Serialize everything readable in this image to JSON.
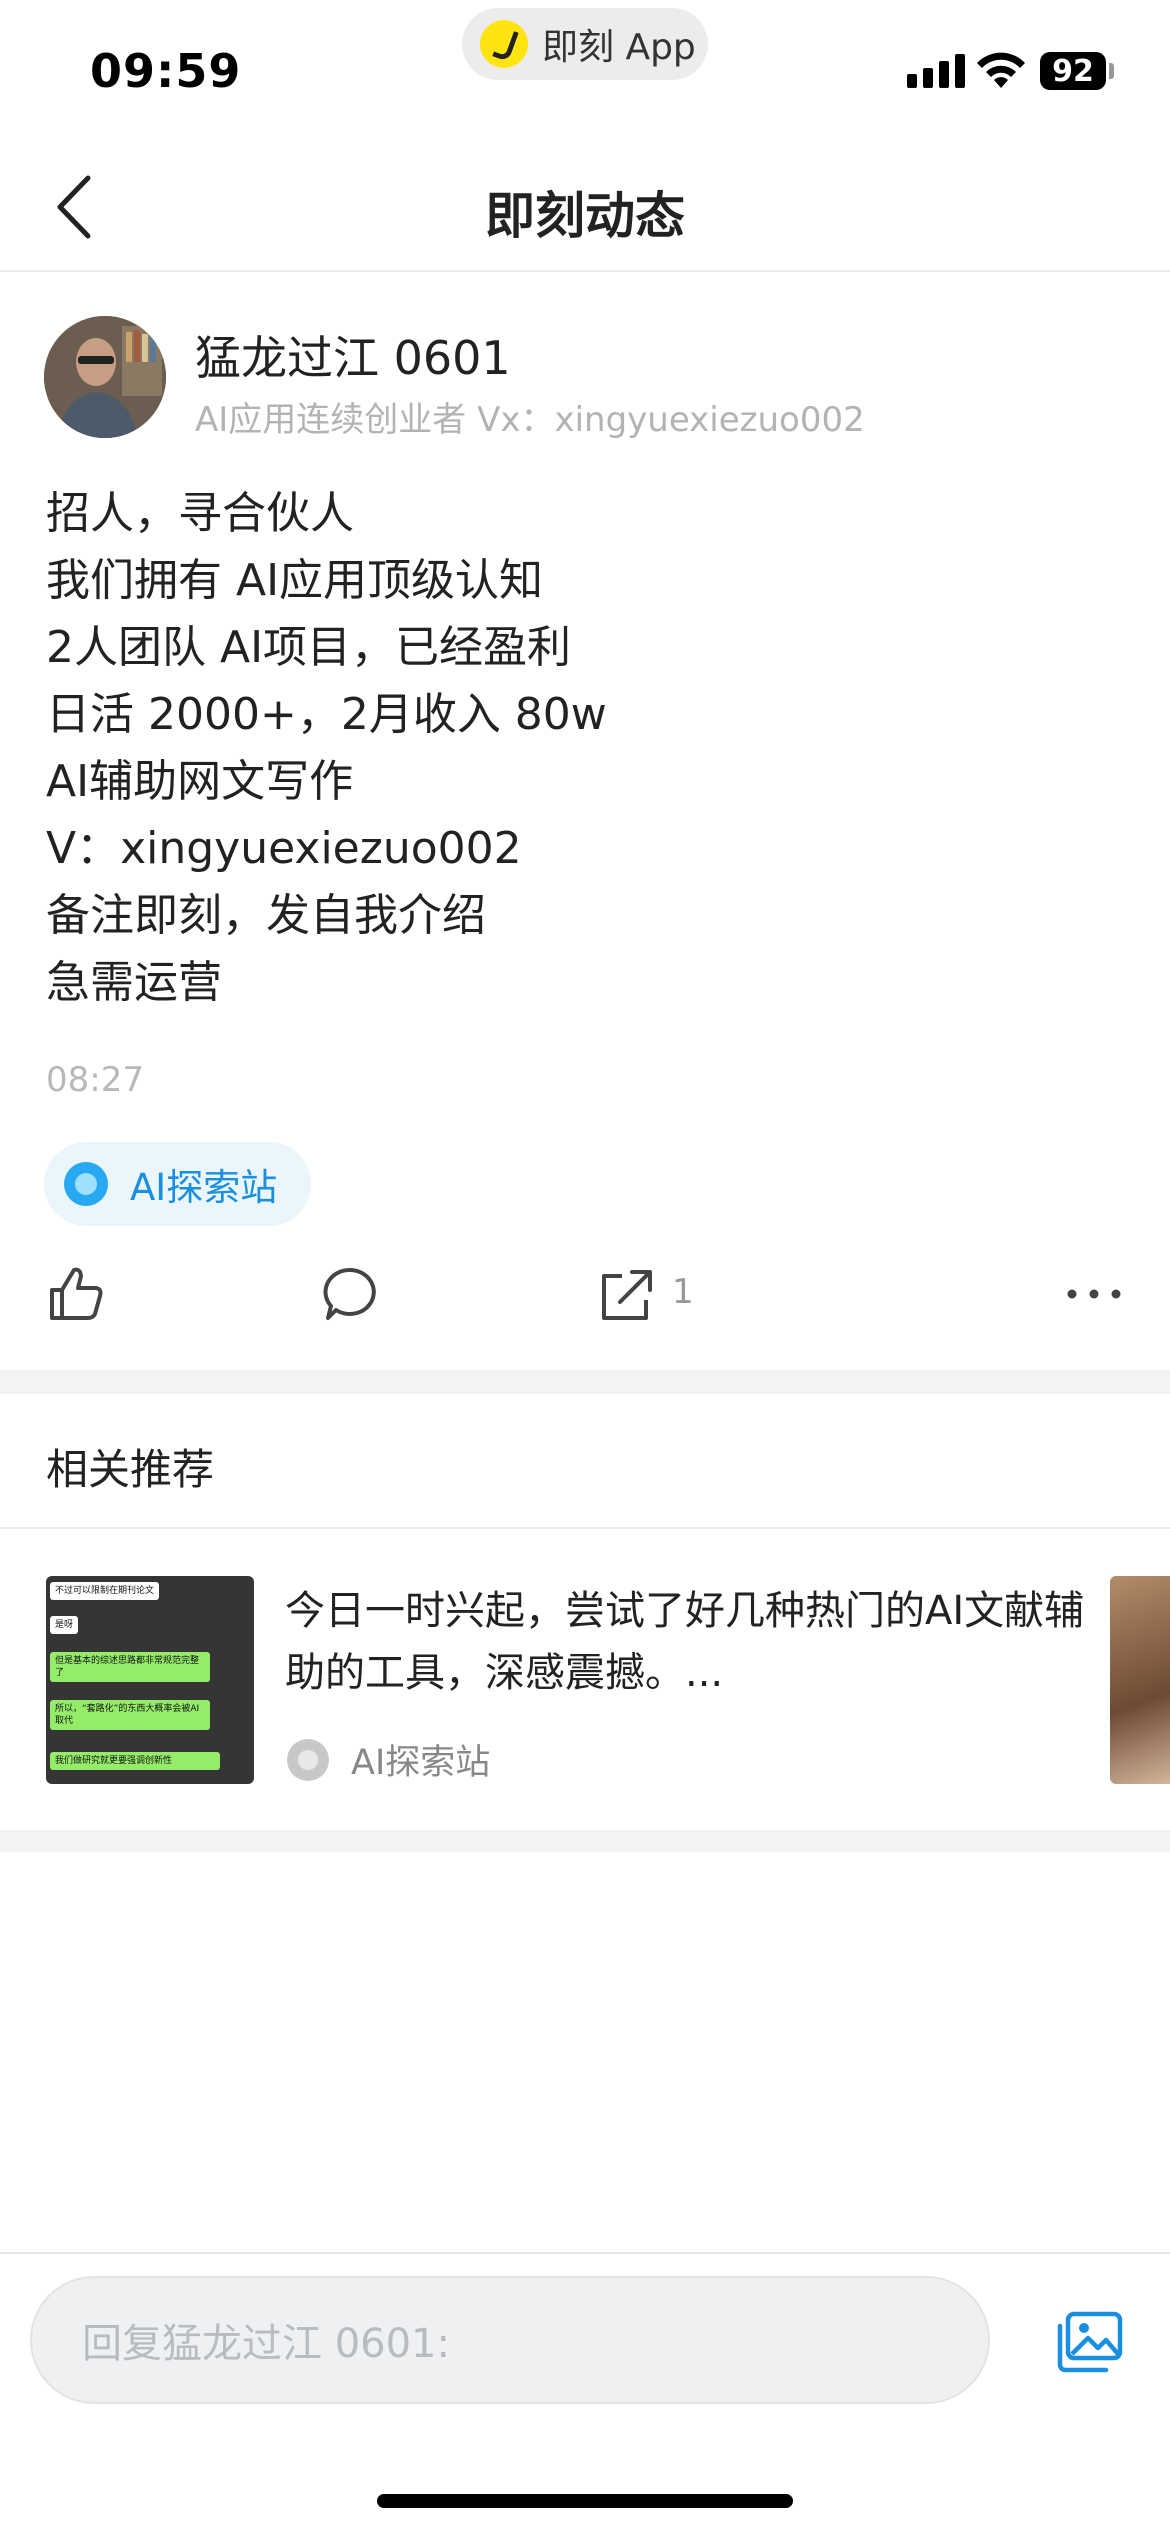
{
  "status_bar": {
    "time": "09:59",
    "app_pill_label": "即刻 App",
    "battery": "92"
  },
  "nav": {
    "title": "即刻动态",
    "back_icon": "chevron-left-icon"
  },
  "author": {
    "name": "猛龙过江 0601",
    "bio": "AI应用连续创业者   Vx：xingyuexiezuo002"
  },
  "post": {
    "lines": [
      "招人，寻合伙人",
      "我们拥有 AI应用顶级认知",
      "2人团队 AI项目，已经盈利",
      "日活 2000+，2月收入 80w",
      "AI辅助网文写作",
      "V：xingyuexiezuo002",
      "备注即刻，发自我介绍",
      "急需运营"
    ],
    "time": "08:27",
    "topic": "AI探索站"
  },
  "actions": {
    "like_icon": "thumbs-up-icon",
    "comment_icon": "comment-icon",
    "share_icon": "share-icon",
    "share_count": "1",
    "more_icon": "more-icon"
  },
  "related": {
    "title": "相关推荐",
    "items": [
      {
        "title": "今日一时兴起，尝试了好几种热门的AI文献辅助的工具，深感震撼。...",
        "topic": "AI探索站",
        "thumb_texts": [
          "不过可以限制在期刊论文",
          "是呀",
          "但是基本的综述思路都非常规范完整了",
          "所以，“套路化”的东西大概率会被AI取代",
          "我们做研究就更要强调创新性"
        ]
      }
    ]
  },
  "reply": {
    "placeholder": "回复猛龙过江 0601:",
    "image_icon": "image-icon"
  },
  "colors": {
    "accent": "#1a8fe0",
    "topic_bg": "#eaf5fc",
    "pill_logo": "#ffe411",
    "muted_text": "#b3b3b3"
  }
}
